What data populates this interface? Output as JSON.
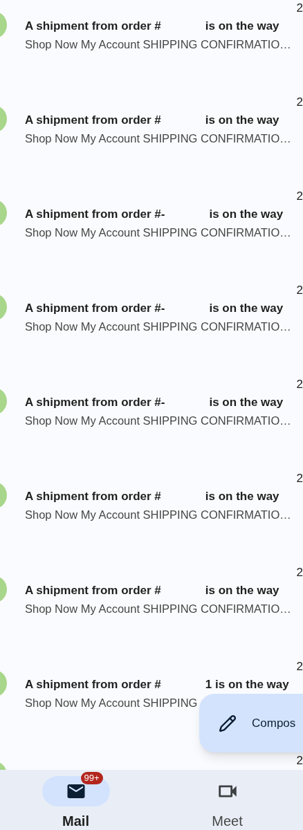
{
  "emails": [
    {
      "subject_start": "A shipment from order #",
      "subject_end": "is on the way",
      "snippet": "Shop Now My Account SHIPPING CONFIRMATIO…",
      "date": "2"
    },
    {
      "subject_start": "A shipment from order #",
      "subject_end": "is on the way",
      "snippet": "Shop Now My Account SHIPPING CONFIRMATIO…",
      "date": "2"
    },
    {
      "subject_start": "A shipment from order #-",
      "subject_end": "is on the way",
      "snippet": "Shop Now My Account SHIPPING CONFIRMATIO…",
      "date": "2"
    },
    {
      "subject_start": "A shipment from order #-",
      "subject_end": "is on the way",
      "snippet": "Shop Now My Account SHIPPING CONFIRMATIO…",
      "date": "2"
    },
    {
      "subject_start": "A shipment from order #-",
      "subject_end": "is on the way",
      "snippet": "Shop Now My Account SHIPPING CONFIRMATIO…",
      "date": "2"
    },
    {
      "subject_start": "A shipment from order #",
      "subject_end": "is on the way",
      "snippet": "Shop Now My Account SHIPPING CONFIRMATIO…",
      "date": "2"
    },
    {
      "subject_start": "A shipment from order #",
      "subject_end": "is on the way",
      "snippet": "Shop Now My Account SHIPPING CONFIRMATIO…",
      "date": "2"
    },
    {
      "subject_start": "A shipment from order #",
      "subject_end": "1 is on the way",
      "snippet": "Shop Now My Account SHIPPING",
      "date": "2"
    }
  ],
  "partial_row": {
    "date": "2"
  },
  "compose": {
    "label": "Compos"
  },
  "nav": [
    {
      "kind": "mail",
      "label": "Mail",
      "selected": true,
      "badge": "99+"
    },
    {
      "kind": "meet",
      "label": "Meet",
      "selected": false
    }
  ]
}
